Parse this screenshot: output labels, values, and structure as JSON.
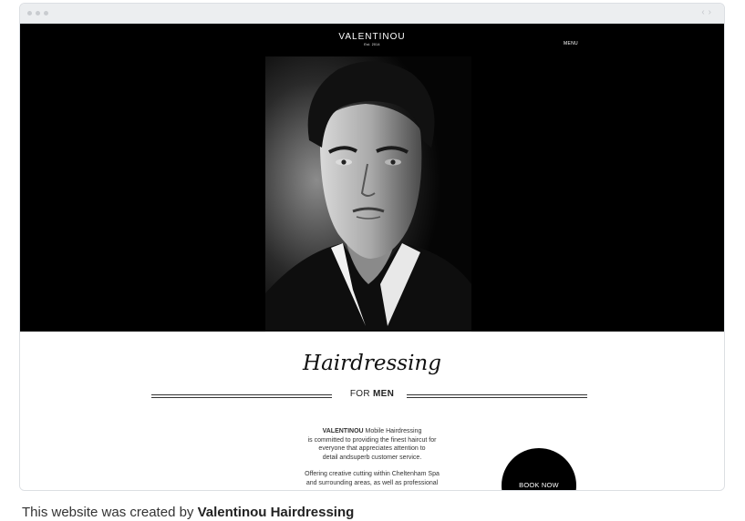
{
  "site": {
    "logo_name": "VALENTINOU",
    "logo_est": "Est. 2014",
    "menu_label": "MENU"
  },
  "section": {
    "script_title": "Hairdressing",
    "subtitle_for": "FOR",
    "subtitle_men": "MEN"
  },
  "intro": {
    "brand": "VALENTINOU",
    "line1": " Mobile Hairdressing",
    "line2": "is committed to providing the finest haircut for",
    "line3": "everyone that appreciates attention to",
    "line4": "detail andsuperb customer service.",
    "line5": "Offering creative cutting within Cheltenham Spa",
    "line6": "and surrounding areas, as well as professional"
  },
  "cta": {
    "book_label": "BOOK NOW"
  },
  "caption": {
    "prefix": "This website was created by ",
    "creator": "Valentinou Hairdressing"
  }
}
